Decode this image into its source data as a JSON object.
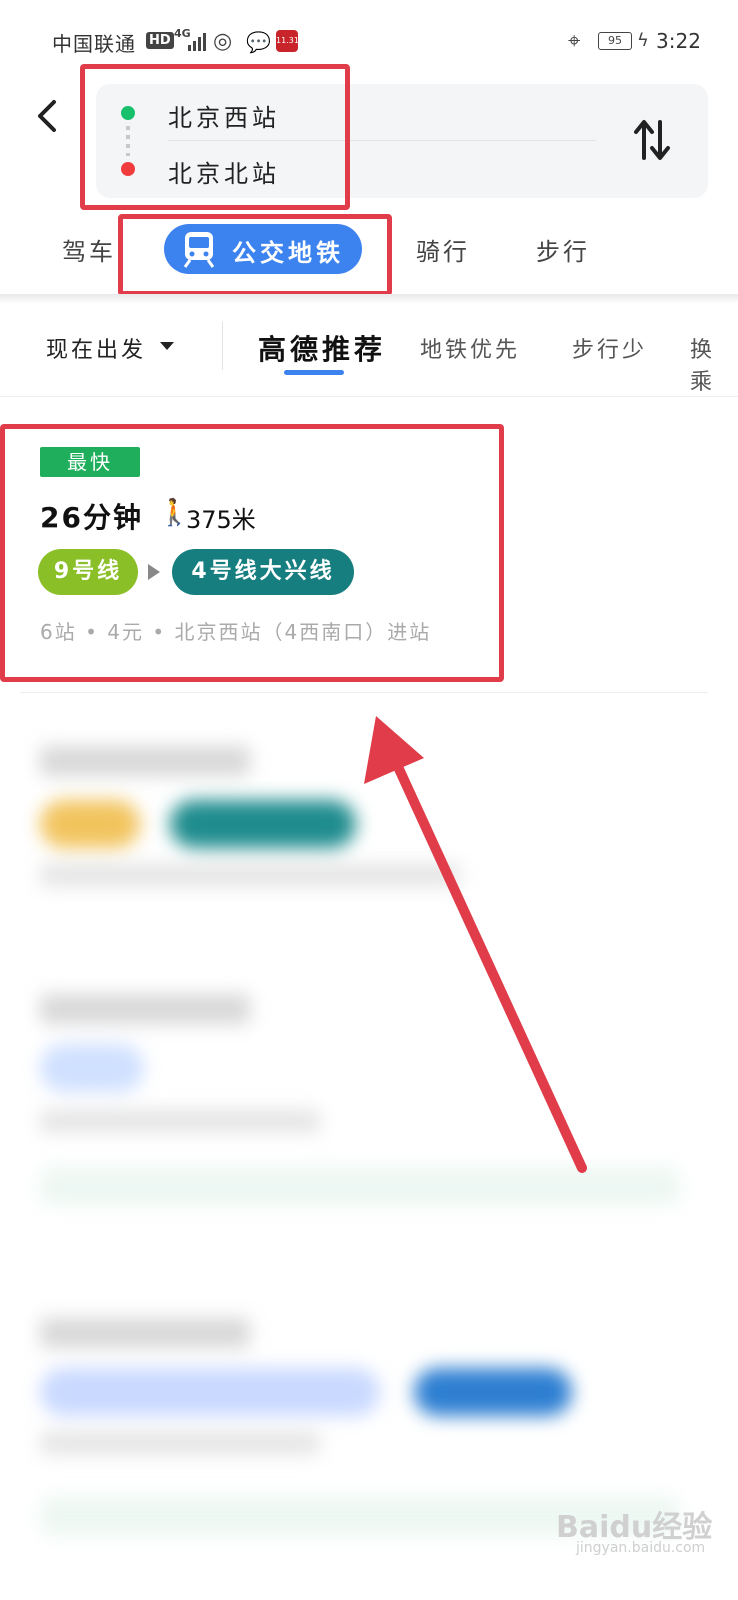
{
  "status_bar": {
    "carrier": "中国联通",
    "hd": "HD",
    "network": "4G",
    "app_badge": "11.31",
    "battery": "95",
    "time": "3:22"
  },
  "header": {
    "back_icon": "chevron-left-icon",
    "from_station": "北京西站",
    "to_station": "北京北站",
    "swap_icon": "swap-vertical-icon"
  },
  "modes": {
    "drive": "驾车",
    "transit": "公交地铁",
    "ride": "骑行",
    "walk": "步行",
    "active": "transit"
  },
  "filters": {
    "depart": "现在出发",
    "options": [
      "高德推荐",
      "地铁优先",
      "步行少",
      "换乘"
    ],
    "active_option": "高德推荐"
  },
  "routes": [
    {
      "badge": "最快",
      "duration": "26分钟",
      "walk_distance": "375米",
      "lines": [
        {
          "name": "9号线",
          "color": "#8bbf27"
        },
        {
          "name": "4号线大兴线",
          "color": "#177e80"
        }
      ],
      "summary": "6站 • 4元 • 北京西站（4西南口）进站"
    }
  ],
  "watermark": {
    "brand": "Baidu经验",
    "url": "jingyan.baidu.com"
  },
  "colors": {
    "accent": "#3d83f0",
    "highlight": "#e03c4a",
    "badge": "#1fae5b"
  }
}
